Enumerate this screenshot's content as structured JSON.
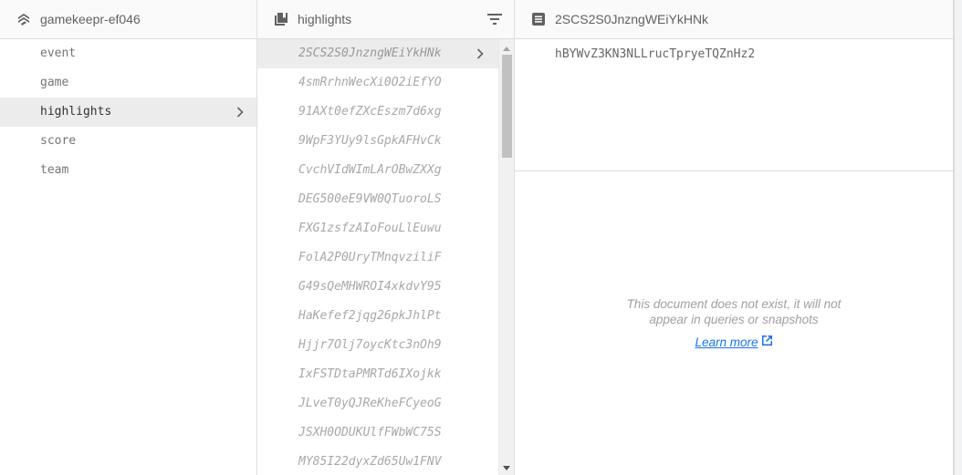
{
  "root_panel": {
    "title": "gamekeepr-ef046",
    "icon": "firestore-root-icon",
    "collections": [
      {
        "label": "event",
        "selected": false
      },
      {
        "label": "game",
        "selected": false
      },
      {
        "label": "highlights",
        "selected": true
      },
      {
        "label": "score",
        "selected": false
      },
      {
        "label": "team",
        "selected": false
      }
    ]
  },
  "collection_panel": {
    "title": "highlights",
    "icon": "collection-icon",
    "filter_icon": "filter-icon",
    "documents": [
      {
        "id": "2SCS2S0JnzngWEiYkHNk",
        "selected": true
      },
      {
        "id": "4smRrhnWecXi0O2iEfYO",
        "selected": false
      },
      {
        "id": "91AXt0efZXcEszm7d6xg",
        "selected": false
      },
      {
        "id": "9WpF3YUy9lsGpkAFHvCk",
        "selected": false
      },
      {
        "id": "CvchVIdWImLArOBwZXXg",
        "selected": false
      },
      {
        "id": "DEG500eE9VW0QTuoroLS",
        "selected": false
      },
      {
        "id": "FXG1zsfzAIoFouLlEuwu",
        "selected": false
      },
      {
        "id": "FolA2P0UryTMnqvziliF",
        "selected": false
      },
      {
        "id": "G49sQeMHWROI4xkdvY95",
        "selected": false
      },
      {
        "id": "HaKefef2jqg26pkJhlPt",
        "selected": false
      },
      {
        "id": "Hjjr7Olj7oycKtc3nOh9",
        "selected": false
      },
      {
        "id": "IxFSTDtaPMRTd6IXojkk",
        "selected": false
      },
      {
        "id": "JLveT0yQJReKheFCyeoG",
        "selected": false
      },
      {
        "id": "JSXH0ODUKUlfFWbWC75S",
        "selected": false
      },
      {
        "id": "MY85I22dyxZd65Uw1FNV",
        "selected": false
      }
    ]
  },
  "document_panel": {
    "title": "2SCS2S0JnzngWEiYkHNk",
    "icon": "document-icon",
    "subcollection": "hBYWvZ3KN3NLLrucTpryeTQZnHz2",
    "empty_message": "This document does not exist, it will not appear in queries or snapshots",
    "learn_more_label": "Learn more",
    "link_color": "#1a73e8"
  }
}
